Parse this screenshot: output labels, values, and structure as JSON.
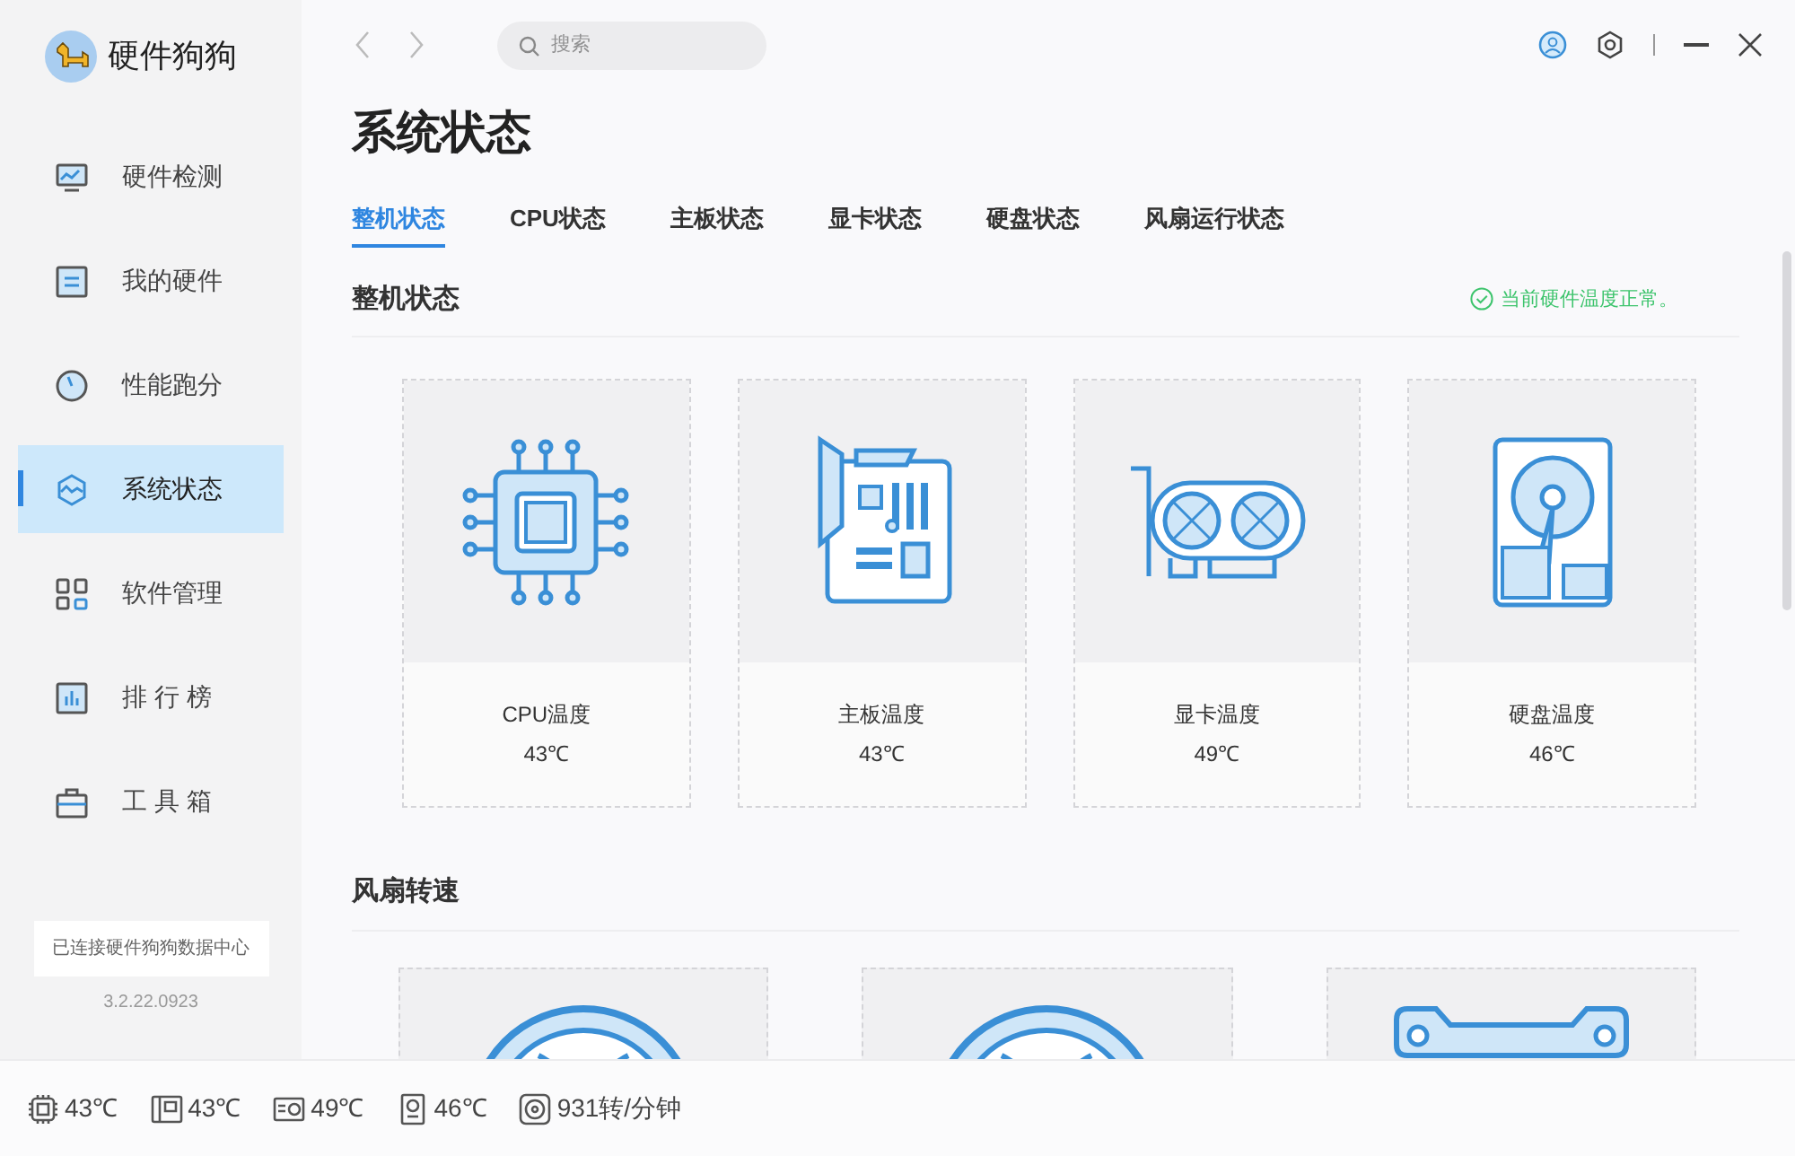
{
  "app": {
    "name": "硬件狗狗"
  },
  "sidebar": {
    "items": [
      {
        "kind": "monitor",
        "label": "硬件检测",
        "selected": false
      },
      {
        "kind": "board",
        "label": "我的硬件",
        "selected": false
      },
      {
        "kind": "gauge",
        "label": "性能跑分",
        "selected": false
      },
      {
        "kind": "wave",
        "label": "系统状态",
        "selected": true
      },
      {
        "kind": "grid",
        "label": "软件管理",
        "selected": false
      },
      {
        "kind": "chart",
        "label": "排 行 榜",
        "selected": false
      },
      {
        "kind": "toolbox",
        "label": "工 具 箱",
        "selected": false
      }
    ],
    "connection": "已连接硬件狗狗数据中心",
    "version": "3.2.22.0923"
  },
  "search": {
    "placeholder": "搜索"
  },
  "page": {
    "title": "系统状态"
  },
  "tabs": [
    {
      "label": "整机状态",
      "selected": true
    },
    {
      "label": "CPU状态",
      "selected": false
    },
    {
      "label": "主板状态",
      "selected": false
    },
    {
      "label": "显卡状态",
      "selected": false
    },
    {
      "label": "硬盘状态",
      "selected": false
    },
    {
      "label": "风扇运行状态",
      "selected": false
    }
  ],
  "overview": {
    "title": "整机状态",
    "status": "当前硬件温度正常。",
    "cards": [
      {
        "kind": "cpu",
        "label": "CPU温度",
        "value": "43℃"
      },
      {
        "kind": "board",
        "label": "主板温度",
        "value": "43℃"
      },
      {
        "kind": "gpu",
        "label": "显卡温度",
        "value": "49℃"
      },
      {
        "kind": "disk",
        "label": "硬盘温度",
        "value": "46℃"
      }
    ]
  },
  "fans": {
    "title": "风扇转速",
    "cards": [
      {
        "kind": "fan"
      },
      {
        "kind": "fan"
      },
      {
        "kind": "bracket"
      }
    ]
  },
  "status_bar": [
    {
      "kind": "cpu",
      "text": "43℃"
    },
    {
      "kind": "board",
      "text": "43℃"
    },
    {
      "kind": "gpu",
      "text": "49℃"
    },
    {
      "kind": "disk",
      "text": "46℃"
    },
    {
      "kind": "fan",
      "text": "931转/分钟"
    }
  ]
}
